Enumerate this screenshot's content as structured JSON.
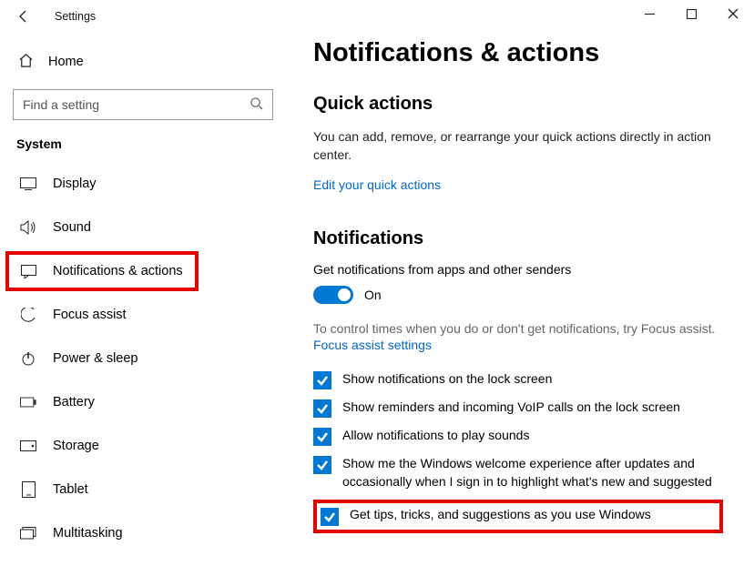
{
  "titlebar": {
    "title": "Settings"
  },
  "sidebar": {
    "home": "Home",
    "search_placeholder": "Find a setting",
    "group": "System",
    "items": [
      {
        "label": "Display"
      },
      {
        "label": "Sound"
      },
      {
        "label": "Notifications & actions"
      },
      {
        "label": "Focus assist"
      },
      {
        "label": "Power & sleep"
      },
      {
        "label": "Battery"
      },
      {
        "label": "Storage"
      },
      {
        "label": "Tablet"
      },
      {
        "label": "Multitasking"
      }
    ]
  },
  "content": {
    "heading": "Notifications & actions",
    "quick": {
      "heading": "Quick actions",
      "body": "You can add, remove, or rearrange your quick actions directly in action center.",
      "link": "Edit your quick actions"
    },
    "notif": {
      "heading": "Notifications",
      "sub": "Get notifications from apps and other senders",
      "toggle_state": "On",
      "hint": "To control times when you do or don't get notifications, try Focus assist.",
      "hint_link": "Focus assist settings",
      "checks": [
        "Show notifications on the lock screen",
        "Show reminders and incoming VoIP calls on the lock screen",
        "Allow notifications to play sounds",
        "Show me the Windows welcome experience after updates and occasionally when I sign in to highlight what's new and suggested",
        "Get tips, tricks, and suggestions as you use Windows"
      ]
    }
  }
}
